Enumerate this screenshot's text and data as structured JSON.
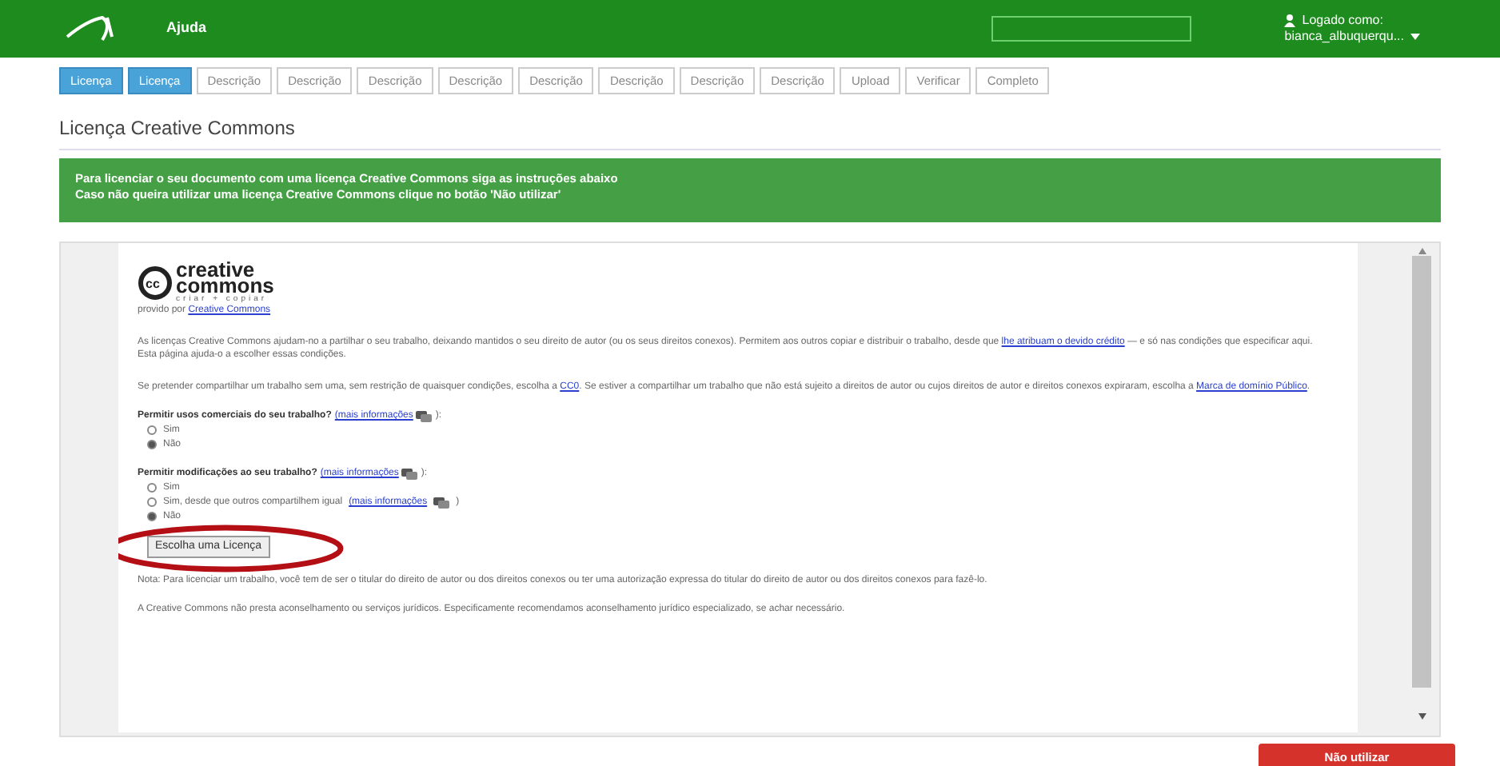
{
  "header": {
    "help": "Ajuda",
    "user_label": "Logado como:",
    "user_name": "bianca_albuquerqu..."
  },
  "tabs": [
    {
      "label": "Licença",
      "selected": true
    },
    {
      "label": "Licença",
      "selected": true
    },
    {
      "label": "Descrição",
      "selected": false
    },
    {
      "label": "Descrição",
      "selected": false
    },
    {
      "label": "Descrição",
      "selected": false
    },
    {
      "label": "Descrição",
      "selected": false
    },
    {
      "label": "Descrição",
      "selected": false
    },
    {
      "label": "Descrição",
      "selected": false
    },
    {
      "label": "Descrição",
      "selected": false
    },
    {
      "label": "Descrição",
      "selected": false
    },
    {
      "label": "Upload",
      "selected": false
    },
    {
      "label": "Verificar",
      "selected": false
    },
    {
      "label": "Completo",
      "selected": false
    }
  ],
  "page_title": "Licença Creative Commons",
  "banner": [
    "Para licenciar o seu documento com uma licença Creative Commons siga as instruções abaixo",
    "Caso não queira utilizar uma licença Creative Commons clique no botão 'Não utilizar'"
  ],
  "license_frame": {
    "logo": {
      "badge": "cc",
      "line_1": "creative",
      "line_2": "commons",
      "tagline": "criar + copiar"
    },
    "provided_by": {
      "text": "provido por",
      "link": "Creative Commons"
    },
    "paragraphs": [
      [
        {
          "kind": "text",
          "text": "As licenças Creative Commons ajudam-no a partilhar o seu trabalho, deixando mantidos o seu direito de autor (ou os seus direitos conexos). Permitem aos outros copiar e distribuir o trabalho, desde que"
        },
        {
          "kind": "link",
          "text": "lhe atribuam o devido crédito"
        },
        {
          "kind": "text",
          "text": "— e só nas condições que especificar aqui. Esta página ajuda-o a escolher essas condições."
        }
      ],
      [
        {
          "kind": "text",
          "text": "Se pretender compartilhar um trabalho sem uma, sem restrição de quaisquer condições, escolha a"
        },
        {
          "kind": "link",
          "text": "CC0"
        },
        {
          "kind": "text",
          "text": ". Se estiver a compartilhar um trabalho que não está sujeito a direitos de autor ou cujos direitos de autor e direitos conexos expiraram, escolha a"
        },
        {
          "kind": "link",
          "text": "Marca de domínio Público"
        },
        {
          "kind": "text",
          "text": "."
        }
      ]
    ],
    "questions": [
      {
        "label": "Permitir usos comerciais do seu trabalho?",
        "more": "(mais informações",
        "close": "):",
        "options": [
          {
            "label": "Sim",
            "selected": false
          },
          {
            "label": "Não",
            "selected": true
          }
        ]
      },
      {
        "label": "Permitir modificações ao seu trabalho?",
        "more": "(mais informações",
        "close": "):",
        "options": [
          {
            "label": "Sim",
            "selected": false
          },
          {
            "label": "Sim, desde que outros compartilhem igual",
            "more": "(mais informações",
            "close": ")",
            "selected": false
          },
          {
            "label": "Não",
            "selected": true
          }
        ]
      }
    ],
    "choose_button": "Escolha uma Licença",
    "notes": [
      "Nota: Para licenciar um trabalho, você tem de ser o titular do direito de autor ou dos direitos conexos ou ter uma autorização expressa do titular do direito de autor ou dos direitos conexos para fazê-lo.",
      "A Creative Commons não presta aconselhamento ou serviços jurídicos. Especificamente recomendamos aconselhamento jurídico especializado, se achar necessário."
    ]
  },
  "decline_button": "Não utilizar"
}
